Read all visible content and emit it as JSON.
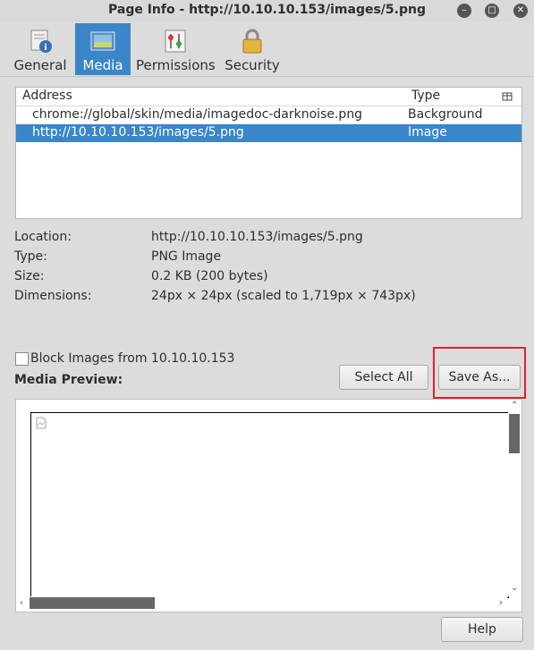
{
  "window": {
    "title": "Page Info - http://10.10.10.153/images/5.png"
  },
  "tabs": [
    {
      "label": "General"
    },
    {
      "label": "Media"
    },
    {
      "label": "Permissions"
    },
    {
      "label": "Security"
    }
  ],
  "list": {
    "header_address": "Address",
    "header_type": "Type",
    "rows": [
      {
        "address": "chrome://global/skin/media/imagedoc-darknoise.png",
        "type": "Background"
      },
      {
        "address": "http://10.10.10.153/images/5.png",
        "type": "Image"
      }
    ]
  },
  "info": {
    "location_label": "Location:",
    "location_value": "http://10.10.10.153/images/5.png",
    "type_label": "Type:",
    "type_value": "PNG Image",
    "size_label": "Size:",
    "size_value": "0.2 KB (200 bytes)",
    "dimensions_label": "Dimensions:",
    "dimensions_value": "24px × 24px (scaled to 1,719px × 743px)"
  },
  "block_images_label": "Block Images from 10.10.10.153",
  "select_all_label": "Select All",
  "save_as_label": "Save As...",
  "media_preview_label": "Media Preview:",
  "help_label": "Help",
  "colors": {
    "accent": "#3a86c8",
    "highlight": "#e0202a"
  }
}
